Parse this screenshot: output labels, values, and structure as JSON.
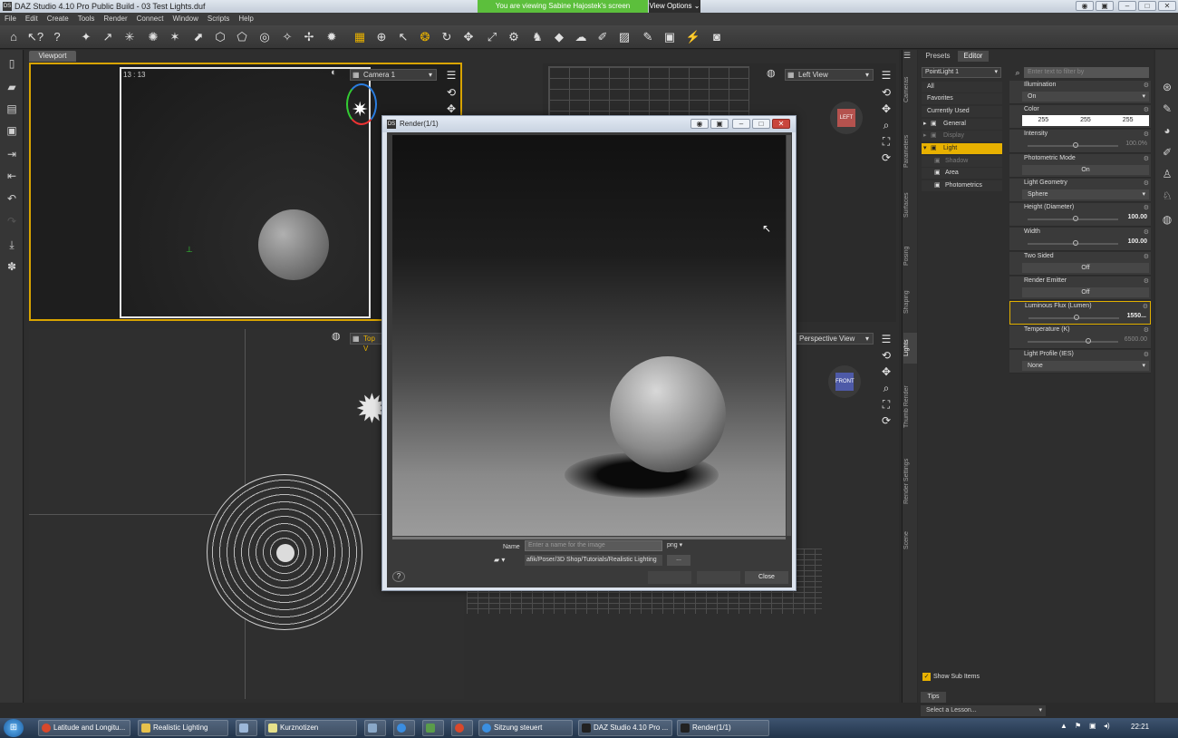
{
  "window": {
    "title": "DAZ Studio 4.10 Pro Public Build - 03 Test Lights.duf",
    "app_icon": "DS",
    "share_banner": "You are viewing Sabine Hajostek's screen",
    "view_options": "View Options"
  },
  "menu": [
    "File",
    "Edit",
    "Create",
    "Tools",
    "Render",
    "Connect",
    "Window",
    "Scripts",
    "Help"
  ],
  "viewport": {
    "tab": "Viewport",
    "frame_time": "13 : 13",
    "camera": "Camera 1",
    "left_view": "Left View",
    "top_view": "Top V",
    "perspective_view": "Perspective View",
    "cube_left": "LEFT",
    "cube_front": "FRONT"
  },
  "render_window": {
    "title": "Render(1/1)",
    "icon": "DS",
    "name_label": "Name",
    "name_placeholder": "Enter a name for the image",
    "format": "png",
    "path": "afik/Poser/3D Shop/Tutorials/Realistic Lighting",
    "browse": "...",
    "help": "?",
    "close": "Close"
  },
  "side_tabs": [
    "Cameras",
    "Parameters",
    "Surfaces",
    "Posing",
    "Shaping",
    "Lights",
    "Thumb Render",
    "Render Settings",
    "Scene"
  ],
  "panel": {
    "tabs": [
      "Presets",
      "Editor"
    ],
    "light_select": "PointLight 1",
    "filter_placeholder": "Enter text to filter by",
    "tree": [
      {
        "label": "All"
      },
      {
        "label": "Favorites"
      },
      {
        "label": "Currently Used"
      },
      {
        "label": "General"
      },
      {
        "label": "Display"
      },
      {
        "label": "Light"
      },
      {
        "label": "Shadow"
      },
      {
        "label": "Area"
      },
      {
        "label": "Photometrics"
      }
    ],
    "properties": {
      "illumination": {
        "label": "Illumination",
        "value": "On"
      },
      "color": {
        "label": "Color",
        "r": "255",
        "g": "255",
        "b": "255"
      },
      "intensity": {
        "label": "Intensity",
        "value": "100.0%"
      },
      "photometric_mode": {
        "label": "Photometric Mode",
        "value": "On"
      },
      "light_geometry": {
        "label": "Light Geometry",
        "value": "Sphere"
      },
      "height": {
        "label": "Height (Diameter)",
        "value": "100.00"
      },
      "width": {
        "label": "Width",
        "value": "100.00"
      },
      "two_sided": {
        "label": "Two Sided",
        "value": "Off"
      },
      "render_emitter": {
        "label": "Render Emitter",
        "value": "Off"
      },
      "luminous_flux": {
        "label": "Luminous Flux (Lumen)",
        "value": "1550..."
      },
      "temperature": {
        "label": "Temperature (K)",
        "value": "6500.00"
      },
      "light_profile": {
        "label": "Light Profile (IES)",
        "value": "None"
      }
    },
    "show_sub_items": "Show Sub Items",
    "tips_tab": "Tips",
    "lesson": "Select a Lesson..."
  },
  "taskbar": {
    "items": [
      "Latitude and Longitu...",
      "Realistic Lighting",
      "Kurznotizen",
      "Sitzung steuert",
      "DAZ Studio 4.10 Pro ...",
      "Render(1/1)"
    ],
    "clock": "22:21"
  },
  "colors": {
    "accent": "#e8b100",
    "banner_green": "#5cbf3c",
    "viewport_border": "#d9a400"
  }
}
